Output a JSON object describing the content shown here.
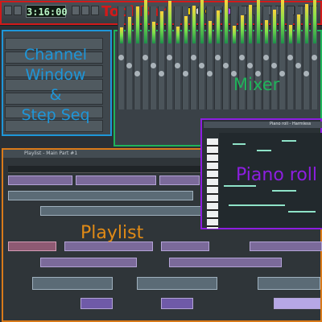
{
  "colors": {
    "toolbar": "#d11a1a",
    "channel_window": "#1e96d9",
    "mixer": "#1fb35a",
    "playlist": "#d97a1a",
    "piano_roll": "#8d1ee0"
  },
  "toolbar": {
    "time": "3:16:00",
    "label": "Tool Bar",
    "dots": [
      "#f0d200",
      "#d6d6d6",
      "#e0a000",
      "#4bc0ff",
      "#b74bff"
    ]
  },
  "channel": {
    "label": "Channel\nWindow\n&\nStep Seq"
  },
  "mixer": {
    "label": "Mixer"
  },
  "playlist": {
    "titlebar": "Playlist - Main Part #1",
    "label": "Playlist"
  },
  "piano_roll": {
    "titlebar": "Piano roll - Harmless",
    "label": "Piano roll"
  }
}
